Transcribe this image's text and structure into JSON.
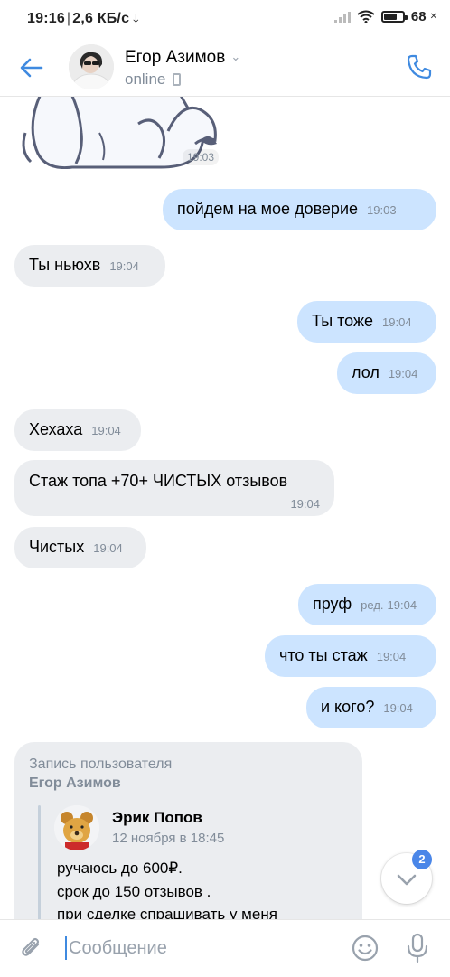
{
  "status_bar": {
    "time": "19:16",
    "speed": "2,6 КБ/с",
    "battery": "68",
    "battery_level": 0.68
  },
  "header": {
    "name": "Егор Азимов",
    "status": "online"
  },
  "sticker": {
    "time": "19:03"
  },
  "messages": [
    {
      "dir": "out",
      "text": "пойдем на мое доверие",
      "time": "19:03"
    },
    {
      "dir": "in",
      "text": "Ты ньюхв",
      "time": "19:04"
    },
    {
      "dir": "out",
      "text": "Ты тоже",
      "time": "19:04"
    },
    {
      "dir": "out",
      "text": "лол",
      "time": "19:04"
    },
    {
      "dir": "in",
      "text": "Хехаха",
      "time": "19:04"
    },
    {
      "dir": "in",
      "text": "Стаж топа +70+ ЧИСТЫХ отзывов",
      "time": "19:04"
    },
    {
      "dir": "in",
      "text": "Чистых",
      "time": "19:04"
    },
    {
      "dir": "out",
      "text": "пруф",
      "edited": "ред.",
      "time": "19:04"
    },
    {
      "dir": "out",
      "text": "что ты стаж",
      "time": "19:04"
    },
    {
      "dir": "out",
      "text": "и кого?",
      "time": "19:04"
    }
  ],
  "repost": {
    "title": "Запись пользователя",
    "author": "Егор Азимов",
    "orig_author": "Эрик Попов",
    "orig_date": "12 ноября в 18:45",
    "lines": [
      "ручаюсь до 600₽.",
      "срок до 150 отзывов .",
      "при сделке спрашивать у меня"
    ]
  },
  "scroll_badge": "2",
  "composer": {
    "placeholder": "Сообщение"
  },
  "colors": {
    "accent": "#3f8ae0",
    "outgoing_bubble": "#cce4ff",
    "incoming_bubble": "#ebedf0",
    "secondary_text": "#818c99",
    "badge": "#4a86e8"
  }
}
